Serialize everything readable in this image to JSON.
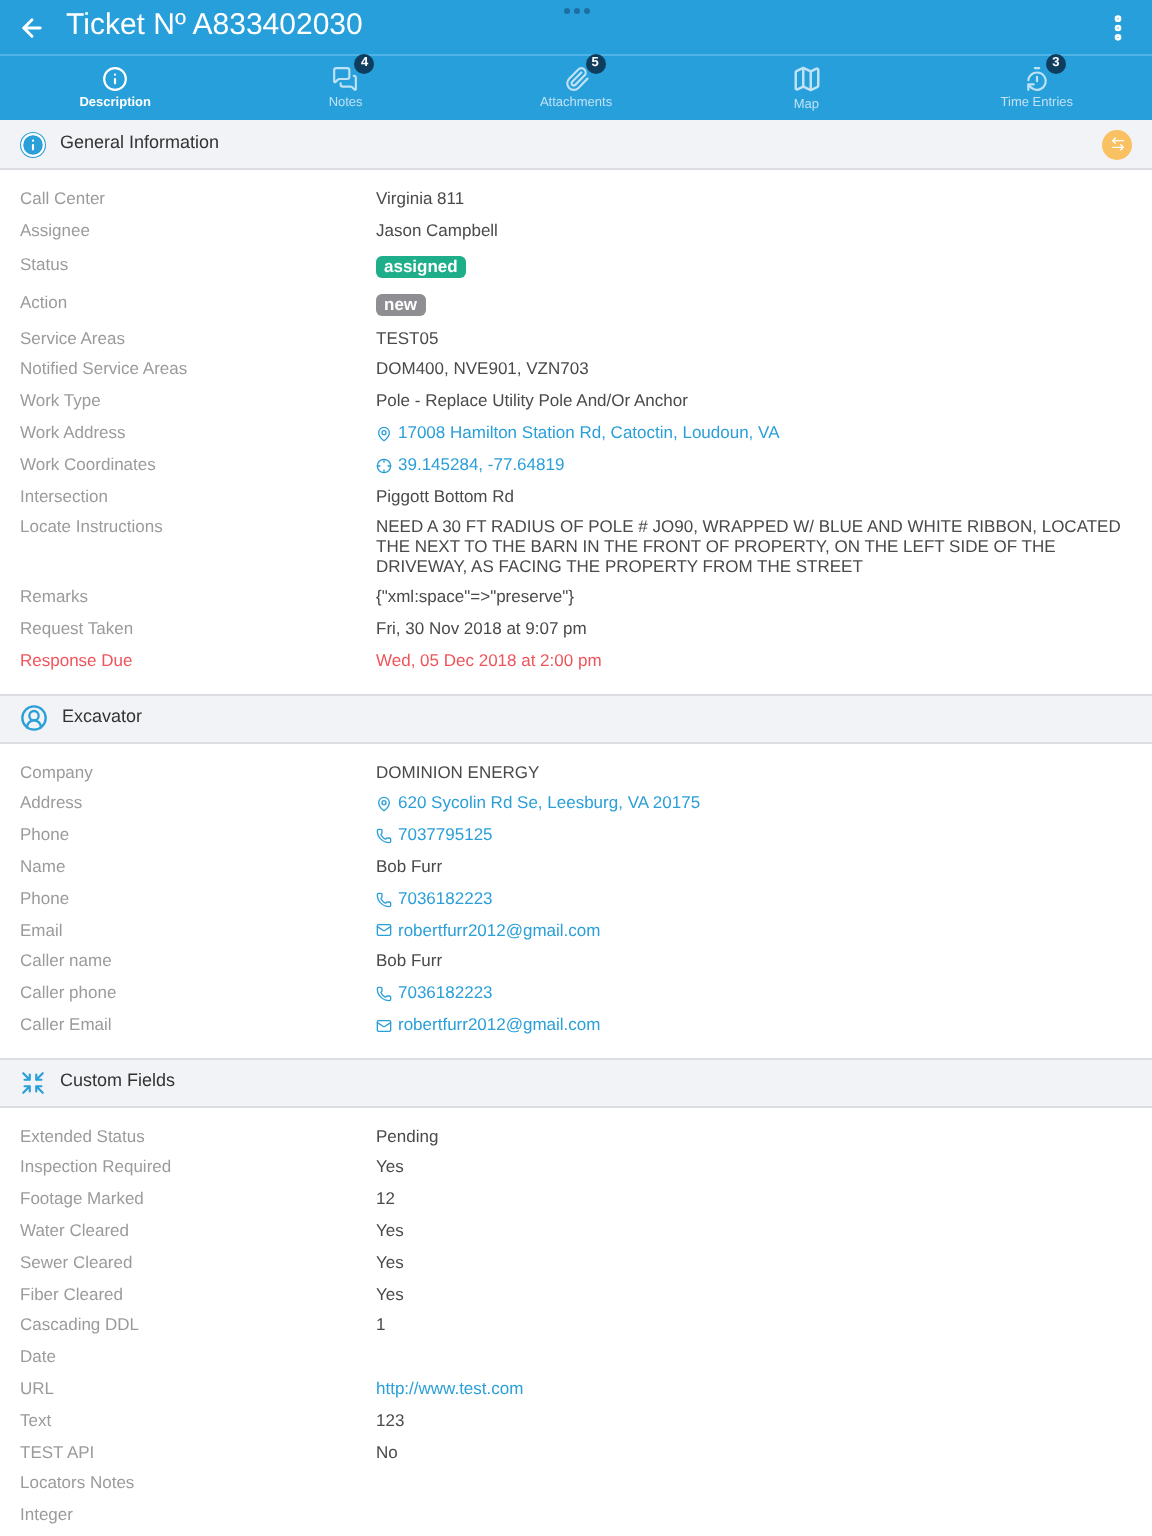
{
  "header": {
    "title": "Ticket Nº A833402030"
  },
  "tabs": [
    {
      "kind": "info",
      "label": "Description",
      "selected": true
    },
    {
      "kind": "notes",
      "label": "Notes",
      "badge": "4",
      "selected": false
    },
    {
      "kind": "attachments",
      "label": "Attachments",
      "badge": "5",
      "selected": false
    },
    {
      "kind": "map",
      "label": "Map",
      "selected": false
    },
    {
      "kind": "time",
      "label": "Time Entries",
      "badge": "3",
      "selected": false
    }
  ],
  "sections": [
    {
      "kind": "info",
      "title": "General Information",
      "action": true,
      "rows": [
        {
          "kind": "text",
          "label": "Call Center",
          "value": "Virginia 811"
        },
        {
          "kind": "text",
          "label": "Assignee",
          "value": "Jason Campbell"
        },
        {
          "kind": "badge",
          "label": "Status",
          "value": "assigned",
          "color": "#1fae8a"
        },
        {
          "kind": "badge",
          "label": "Action",
          "value": "new",
          "color": "#8e8e93"
        },
        {
          "kind": "text",
          "label": "Service Areas",
          "value": "TEST05"
        },
        {
          "kind": "text",
          "label": "Notified Service Areas",
          "value": "DOM400, NVE901, VZN703"
        },
        {
          "kind": "text",
          "label": "Work Type",
          "value": "Pole - Replace Utility Pole And/Or Anchor"
        },
        {
          "kind": "address",
          "label": "Work Address",
          "value": "17008 Hamilton Station Rd, Catoctin, Loudoun, VA"
        },
        {
          "kind": "coordinates",
          "label": "Work Coordinates",
          "value": "39.145284, -77.64819"
        },
        {
          "kind": "text",
          "label": "Intersection",
          "value": "Piggott Bottom Rd"
        },
        {
          "kind": "text",
          "label": "Locate Instructions",
          "value": "NEED A 30 FT RADIUS OF POLE # JO90, WRAPPED W/ BLUE AND WHITE RIBBON, LOCATED THE NEXT TO THE BARN IN THE FRONT OF PROPERTY, ON THE LEFT SIDE OF THE DRIVEWAY, AS FACING THE PROPERTY FROM THE STREET"
        },
        {
          "kind": "text",
          "label": "Remarks",
          "value": "{\"xml:space\"=>\"preserve\"}"
        },
        {
          "kind": "text",
          "label": "Request Taken",
          "value": "Fri, 30 Nov 2018 at 9:07 pm"
        },
        {
          "kind": "alert",
          "label": "Response Due",
          "value": "Wed, 05 Dec 2018 at 2:00 pm"
        }
      ]
    },
    {
      "kind": "person",
      "title": "Excavator",
      "action": false,
      "rows": [
        {
          "kind": "text",
          "label": "Company",
          "value": "DOMINION ENERGY"
        },
        {
          "kind": "address",
          "label": "Address",
          "value": "620 Sycolin Rd Se, Leesburg, VA 20175"
        },
        {
          "kind": "phone",
          "label": "Phone",
          "value": "7037795125"
        },
        {
          "kind": "text",
          "label": "Name",
          "value": "Bob Furr"
        },
        {
          "kind": "phone",
          "label": "Phone",
          "value": "7036182223"
        },
        {
          "kind": "email",
          "label": "Email",
          "value": "robertfurr2012@gmail.com"
        },
        {
          "kind": "text",
          "label": "Caller name",
          "value": "Bob Furr"
        },
        {
          "kind": "phone",
          "label": "Caller phone",
          "value": "7036182223"
        },
        {
          "kind": "email",
          "label": "Caller Email",
          "value": "robertfurr2012@gmail.com"
        }
      ]
    },
    {
      "kind": "custom",
      "title": "Custom Fields",
      "action": false,
      "rows": [
        {
          "kind": "text",
          "label": "Extended Status",
          "value": "Pending"
        },
        {
          "kind": "text",
          "label": "Inspection Required",
          "value": "Yes"
        },
        {
          "kind": "text",
          "label": "Footage Marked",
          "value": "12"
        },
        {
          "kind": "text",
          "label": "Water Cleared",
          "value": "Yes"
        },
        {
          "kind": "text",
          "label": "Sewer Cleared",
          "value": "Yes"
        },
        {
          "kind": "text",
          "label": "Fiber Cleared",
          "value": "Yes"
        },
        {
          "kind": "text",
          "label": "Cascading DDL",
          "value": "1"
        },
        {
          "kind": "text",
          "label": "Date"
        },
        {
          "kind": "link",
          "label": "URL",
          "value": "http://www.test.com"
        },
        {
          "kind": "text",
          "label": "Text",
          "value": "123"
        },
        {
          "kind": "text",
          "label": "TEST API",
          "value": "No"
        },
        {
          "kind": "text",
          "label": "Locators Notes"
        },
        {
          "kind": "text",
          "label": "Integer"
        }
      ]
    }
  ]
}
